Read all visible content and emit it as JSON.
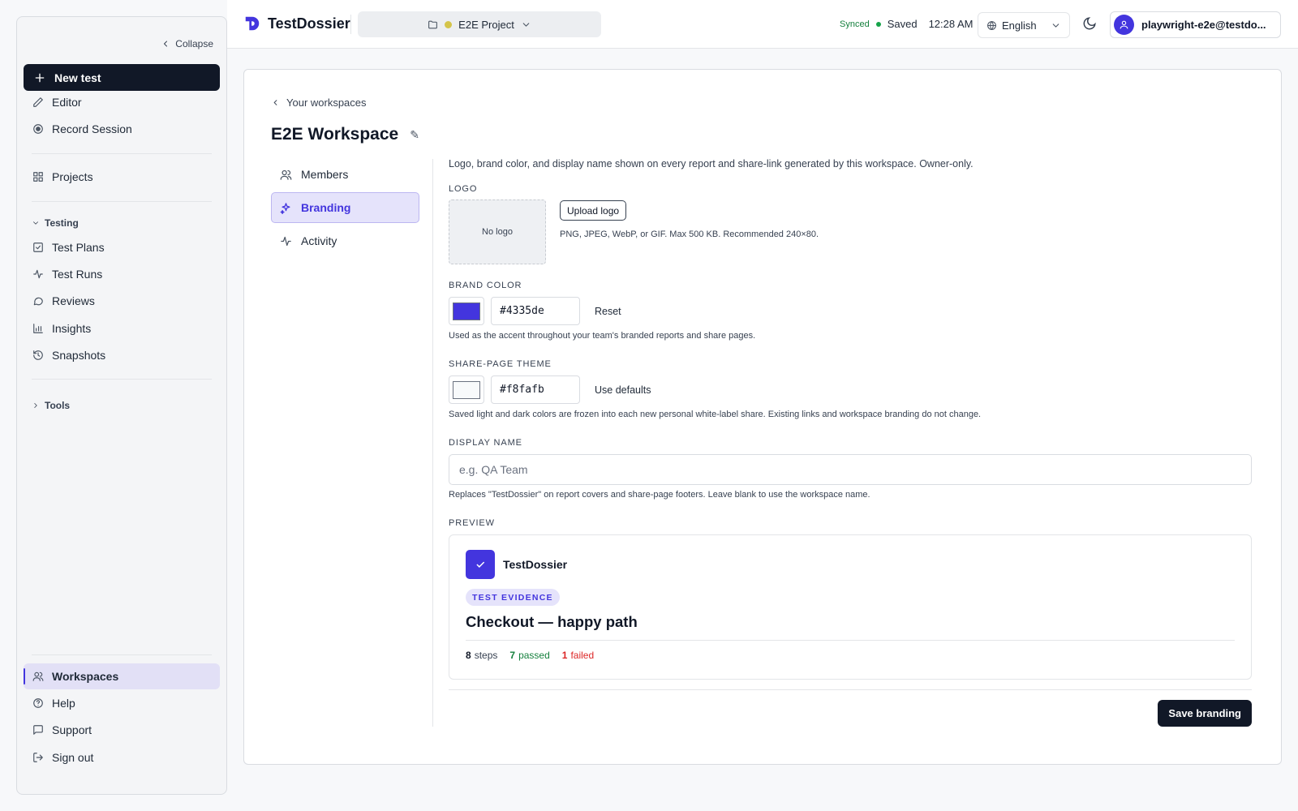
{
  "sidebar": {
    "collapse_label": "Collapse",
    "new_test_label": "New test",
    "items_top": [
      {
        "label": "Editor",
        "icon": "pencil-icon"
      },
      {
        "label": "Record Session",
        "icon": "record-icon"
      }
    ],
    "projects_label": "Projects",
    "testing_section": "Testing",
    "testing_items": [
      {
        "label": "Test Plans",
        "icon": "checklist-icon"
      },
      {
        "label": "Test Runs",
        "icon": "activity-icon"
      },
      {
        "label": "Reviews",
        "icon": "message-icon"
      },
      {
        "label": "Insights",
        "icon": "bar-chart-icon"
      },
      {
        "label": "Snapshots",
        "icon": "history-icon"
      }
    ],
    "tools_section": "Tools",
    "bottom_items": [
      {
        "label": "Workspaces",
        "icon": "users-icon",
        "active": true
      },
      {
        "label": "Help",
        "icon": "help-icon"
      },
      {
        "label": "Support",
        "icon": "message-icon"
      },
      {
        "label": "Sign out",
        "icon": "logout-icon"
      }
    ]
  },
  "topbar": {
    "brand": "TestDossier",
    "project": "E2E Project",
    "sync_status": "Synced",
    "save_status": "Saved",
    "time": "12:28 AM",
    "language": "English",
    "user_email": "playwright-e2e@testdo..."
  },
  "page": {
    "back_label": "Your workspaces",
    "title": "E2E Workspace",
    "tabs": [
      {
        "label": "Members",
        "icon": "users-icon"
      },
      {
        "label": "Branding",
        "icon": "sparkles-icon",
        "active": true
      },
      {
        "label": "Activity",
        "icon": "activity-icon"
      }
    ]
  },
  "branding": {
    "description": "Logo, brand color, and display name shown on every report and share-link generated by this workspace. Owner-only.",
    "logo_label": "LOGO",
    "no_logo": "No logo",
    "upload_label": "Upload logo",
    "logo_hint": "PNG, JPEG, WebP, or GIF. Max 500 KB. Recommended 240×80.",
    "brand_color_label": "BRAND COLOR",
    "brand_color_value": "#4335de",
    "reset_label": "Reset",
    "brand_color_hint": "Used as the accent throughout your team's branded reports and share pages.",
    "theme_label": "SHARE-PAGE THEME",
    "theme_value": "#f8fafb",
    "use_defaults_label": "Use defaults",
    "theme_hint": "Saved light and dark colors are frozen into each new personal white-label share. Existing links and workspace branding do not change.",
    "display_name_label": "DISPLAY NAME",
    "display_name_placeholder": "e.g. QA Team",
    "display_name_hint": "Replaces \"TestDossier\" on report covers and share-page footers. Leave blank to use the workspace name.",
    "preview_label": "PREVIEW",
    "save_label": "Save branding"
  },
  "preview": {
    "brand_name": "TestDossier",
    "badge": "TEST EVIDENCE",
    "title": "Checkout — happy path",
    "steps_count": "8",
    "steps_label": "steps",
    "passed_count": "7",
    "passed_label": "passed",
    "failed_count": "1",
    "failed_label": "failed"
  },
  "colors": {
    "accent": "#4335de",
    "primary_dark": "#111827",
    "pass": "#15803d",
    "fail": "#dc2626",
    "project_dot": "#d4c44a"
  }
}
